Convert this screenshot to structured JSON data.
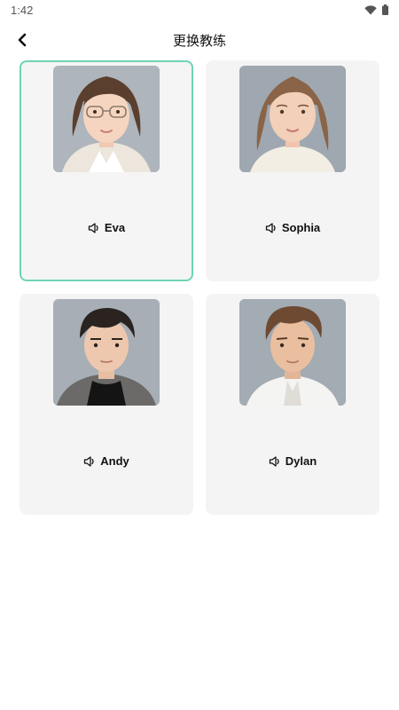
{
  "status_bar": {
    "time": "1:42",
    "icons": [
      "wifi-icon",
      "battery-icon"
    ]
  },
  "header": {
    "title": "更换教练",
    "back_icon": "chevron-left-icon"
  },
  "coaches": [
    {
      "name": "Eva",
      "selected": true,
      "icon": "speaker-icon"
    },
    {
      "name": "Sophia",
      "selected": false,
      "icon": "speaker-icon"
    },
    {
      "name": "Andy",
      "selected": false,
      "icon": "speaker-icon"
    },
    {
      "name": "Dylan",
      "selected": false,
      "icon": "speaker-icon"
    }
  ],
  "colors": {
    "selected_border": "#6fd4b7",
    "card_background": "#f4f4f4"
  }
}
